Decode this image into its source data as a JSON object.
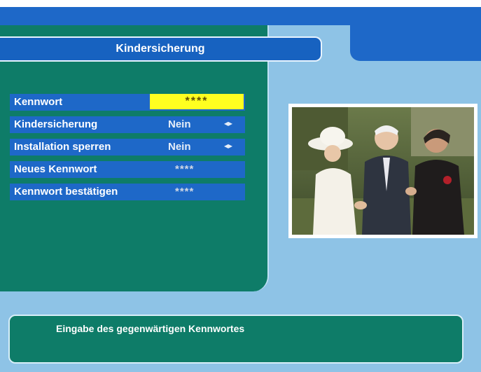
{
  "title": "Kindersicherung",
  "menu": [
    {
      "label": "Kennwort",
      "value": "****"
    },
    {
      "label": "Kindersicherung",
      "value": "Nein",
      "arrow": "◂▸"
    },
    {
      "label": "Installation sperren",
      "value": "Nein",
      "arrow": "◂▸"
    },
    {
      "label": "Neues Kennwort",
      "value": "****"
    },
    {
      "label": "Kennwort bestätigen",
      "value": "****"
    }
  ],
  "hint": "Eingabe des gegenwärtigen Kennwortes",
  "colors": {
    "background": "#8ec3e6",
    "panel_green": "#0e7c68",
    "row_blue": "#1e68c8",
    "highlight_yellow": "#ffff20"
  },
  "preview": {
    "icon": "tv-preview-image"
  }
}
